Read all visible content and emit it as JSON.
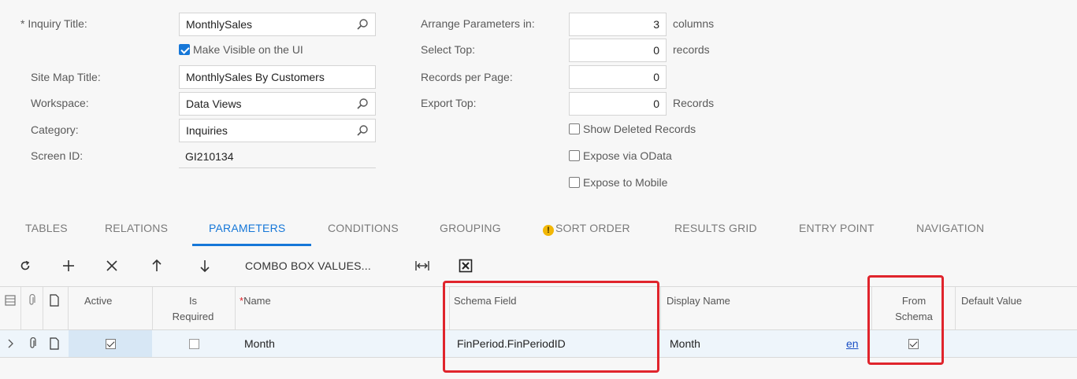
{
  "form": {
    "inquiry_title_label": "* Inquiry Title:",
    "inquiry_title_value": "MonthlySales",
    "make_visible_label": "Make Visible on the UI",
    "make_visible_checked": true,
    "site_map_title_label": "Site Map Title:",
    "site_map_title_value": "MonthlySales By Customers",
    "workspace_label": "Workspace:",
    "workspace_value": "Data Views",
    "category_label": "Category:",
    "category_value": "Inquiries",
    "screen_id_label": "Screen ID:",
    "screen_id_value": "GI210134",
    "arrange_label": "Arrange Parameters in:",
    "arrange_value": "3",
    "arrange_unit": "columns",
    "select_top_label": "Select Top:",
    "select_top_value": "0",
    "select_top_unit": "records",
    "records_per_page_label": "Records per Page:",
    "records_per_page_value": "0",
    "export_top_label": "Export Top:",
    "export_top_value": "0",
    "export_top_unit": "Records",
    "show_deleted_label": "Show Deleted Records",
    "expose_odata_label": "Expose via OData",
    "expose_mobile_label": "Expose to Mobile"
  },
  "tabs": [
    {
      "label": "TABLES"
    },
    {
      "label": "RELATIONS"
    },
    {
      "label": "PARAMETERS"
    },
    {
      "label": "CONDITIONS"
    },
    {
      "label": "GROUPING"
    },
    {
      "label": "SORT ORDER"
    },
    {
      "label": "RESULTS GRID"
    },
    {
      "label": "ENTRY POINT"
    },
    {
      "label": "NAVIGATION"
    }
  ],
  "active_tab": "PARAMETERS",
  "toolbar": {
    "combo_box_values_label": "COMBO BOX VALUES..."
  },
  "grid": {
    "headers": {
      "active": "Active",
      "is_required_1": "Is",
      "is_required_2": "Required",
      "name_star": "*",
      "name": "Name",
      "schema_field": "Schema Field",
      "display_name": "Display Name",
      "from_schema_1": "From",
      "from_schema_2": "Schema",
      "default_value": "Default Value"
    },
    "rows": [
      {
        "active": true,
        "is_required": false,
        "name": "Month",
        "schema_field": "FinPeriod.FinPeriodID",
        "display_name": "Month",
        "locale_link": "en",
        "from_schema": true,
        "default_value": ""
      }
    ]
  },
  "colors": {
    "accent": "#1677d8",
    "highlight_box": "#e0242c",
    "warning": "#f2b705"
  }
}
